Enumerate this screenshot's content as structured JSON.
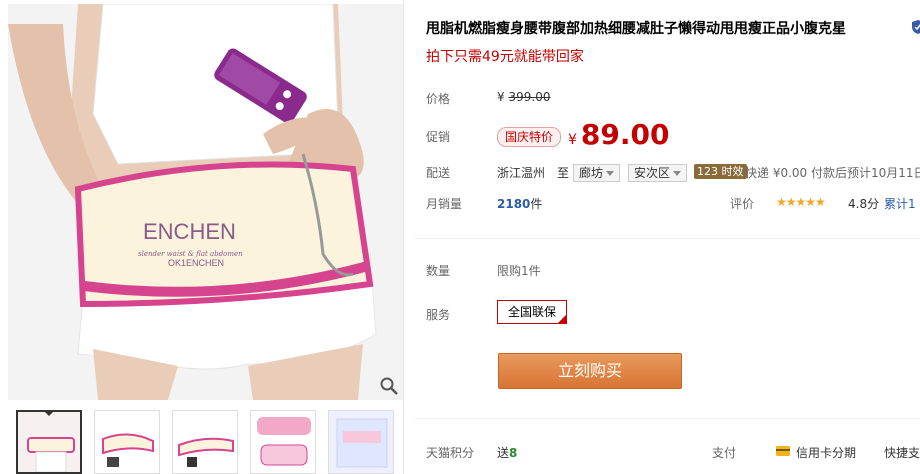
{
  "product": {
    "title": "甩脂机燃脂瘦身腰带腹部加热细腰减肚子懒得动甩甩瘦正品小腹克星",
    "subtitle": "拍下只需49元就能带回家"
  },
  "gallery": {
    "brand_text": "ENCHEN",
    "brand_sub": "slender waist & flat abdomen",
    "brand_logo": "OK1ENCHEN",
    "thumb_count": 5
  },
  "price_row": {
    "label": "价格",
    "currency": "¥",
    "original": "399.00"
  },
  "promo_row": {
    "label": "促销",
    "badge": "国庆特价",
    "currency": "¥",
    "price": "89.00"
  },
  "delivery": {
    "label": "配送",
    "origin": "浙江温州",
    "to": "至",
    "city": "廊坊",
    "district": "安次区",
    "fast_tag": "123 时效",
    "shipping": "快递 ¥0.00 付款后预计10月11日"
  },
  "monthly": {
    "label": "月销量",
    "count": "2180",
    "unit": "件",
    "rating_label": "评价",
    "stars": "★★★★★",
    "score": "4.8分",
    "total": "累计1"
  },
  "quantity": {
    "label": "数量",
    "limit": "限购1件"
  },
  "service": {
    "label": "服务",
    "option": "全国联保"
  },
  "buy_button": "立刻购买",
  "bottom": {
    "points_label": "天猫积分",
    "points_prefix": "送",
    "points_value": "8",
    "pay_label": "支付",
    "credit": "信用卡分期",
    "quick": "快捷支"
  },
  "colors": {
    "accent": "#c40000",
    "buy": "#e08040",
    "link": "#2a5caa"
  }
}
